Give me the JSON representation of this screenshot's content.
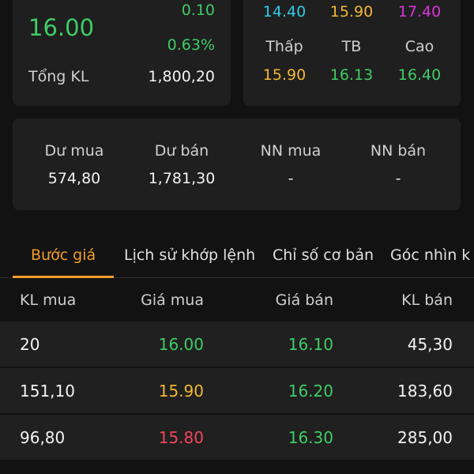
{
  "price_card": {
    "price": "16.00",
    "change": "0.10",
    "change_pct": "0.63%",
    "volume_label": "Tổng KL",
    "volume_value": "1,800,20"
  },
  "ref_card": {
    "floor": "14.40",
    "reference": "15.90",
    "ceiling": "17.40",
    "low_label": "Thấp",
    "avg_label": "TB",
    "high_label": "Cao",
    "low": "15.90",
    "avg": "16.13",
    "high": "16.40"
  },
  "depth_card": {
    "items": [
      {
        "label": "Dư mua",
        "value": "574,80"
      },
      {
        "label": "Dư bán",
        "value": "1,781,30"
      },
      {
        "label": "NN mua",
        "value": "-"
      },
      {
        "label": "NN bán",
        "value": "-"
      }
    ]
  },
  "tabs": [
    {
      "label": "Bước giá",
      "active": true
    },
    {
      "label": "Lịch sử khớp lệnh",
      "active": false
    },
    {
      "label": "Chỉ số cơ bản",
      "active": false
    },
    {
      "label": "Góc nhìn k",
      "active": false
    }
  ],
  "orderbook": {
    "headers": {
      "bid_vol": "KL mua",
      "bid_price": "Giá mua",
      "ask_price": "Giá bán",
      "ask_vol": "KL bán"
    },
    "rows": [
      {
        "bid_vol": "20",
        "bid_price": "16.00",
        "bid_color": "green",
        "ask_price": "16.10",
        "ask_color": "green",
        "ask_vol": "45,30"
      },
      {
        "bid_vol": "151,10",
        "bid_price": "15.90",
        "bid_color": "yellow",
        "ask_price": "16.20",
        "ask_color": "green",
        "ask_vol": "183,60"
      },
      {
        "bid_vol": "96,80",
        "bid_price": "15.80",
        "bid_color": "red",
        "ask_price": "16.30",
        "ask_color": "green",
        "ask_vol": "285,00"
      }
    ]
  },
  "colors": {
    "up": "#3fcc66",
    "reference": "#f1b733",
    "floor": "#2fc9e6",
    "ceiling": "#dd33dd",
    "down": "#f0455a",
    "accent": "#f39c2b"
  }
}
